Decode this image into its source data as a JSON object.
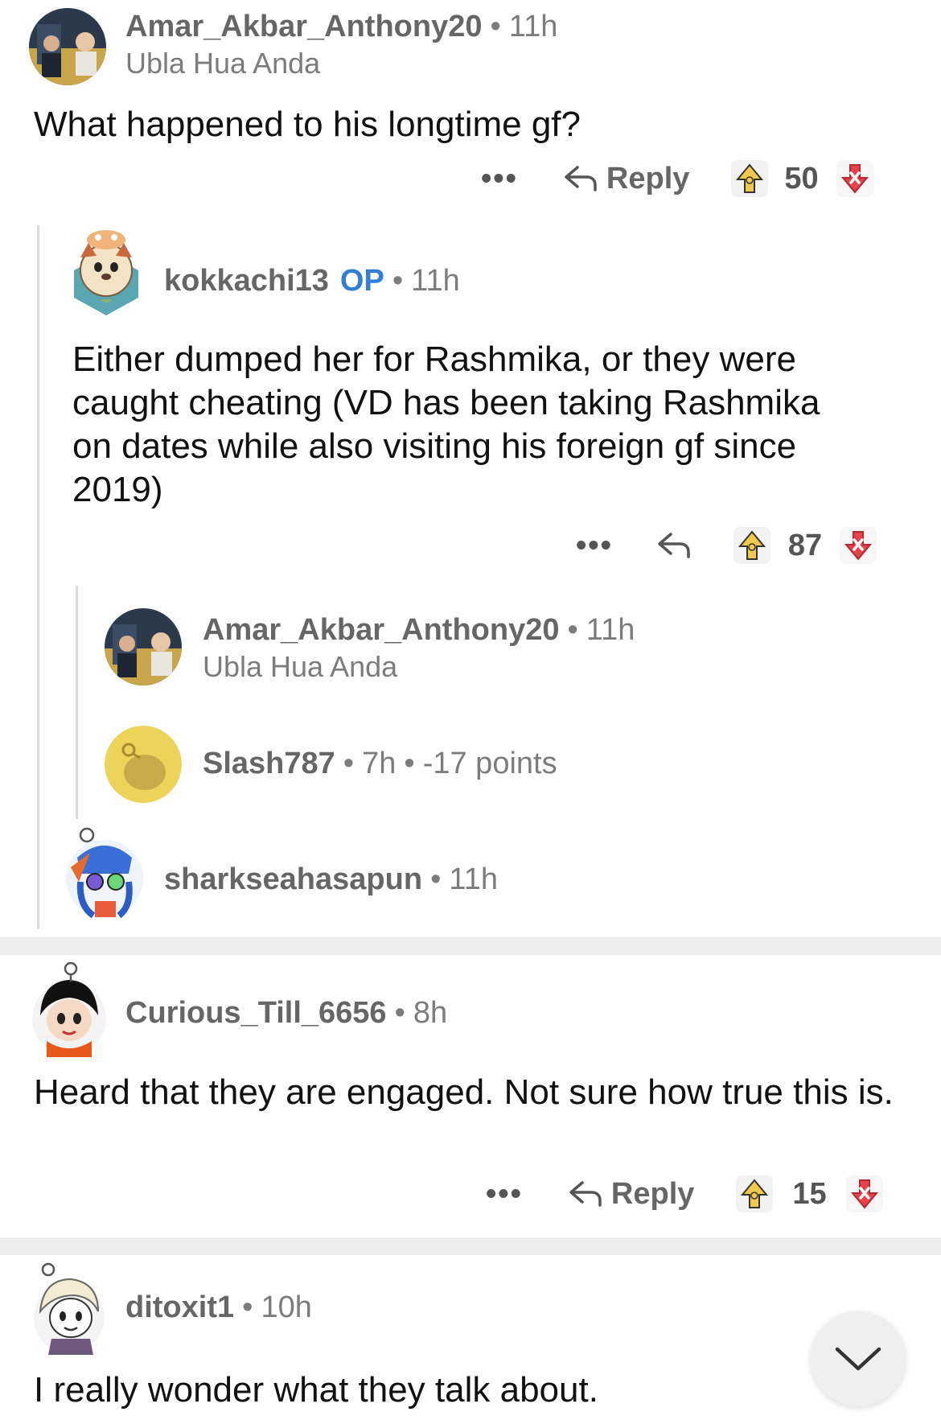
{
  "comments": [
    {
      "username": "Amar_Akbar_Anthony20",
      "time": "11h",
      "flair": "Ubla Hua Anda",
      "text": "What happened to his longtime gf?",
      "reply": "Reply",
      "score": "50"
    },
    {
      "username": "kokkachi13",
      "op": "OP",
      "time": "11h",
      "text": "Either dumped her for Rashmika, or they were caught cheating (VD has been taking Rashmika on dates while also visiting his foreign gf since 2019)",
      "score": "87"
    },
    {
      "username": "Amar_Akbar_Anthony20",
      "time": "11h",
      "flair": "Ubla Hua Anda"
    },
    {
      "username": "Slash787",
      "time": "7h",
      "points": "-17 points"
    },
    {
      "username": "sharkseahasapun",
      "time": "11h"
    },
    {
      "username": "Curious_Till_6656",
      "time": "8h",
      "text": "Heard that they are engaged. Not sure how true this is.",
      "reply": "Reply",
      "score": "15"
    },
    {
      "username": "ditoxit1",
      "time": "10h",
      "text": "I really wonder what they talk about."
    }
  ],
  "icons": {
    "more": "more-icon",
    "reply": "reply-arrow-icon",
    "upvote": "upvote-icon",
    "downvote": "downvote-icon",
    "collapse": "chevron-down-icon"
  },
  "colors": {
    "op": "#2f7fd8",
    "upvote": "#f2c94c",
    "downvote": "#e8434c"
  },
  "more_label": "•••"
}
